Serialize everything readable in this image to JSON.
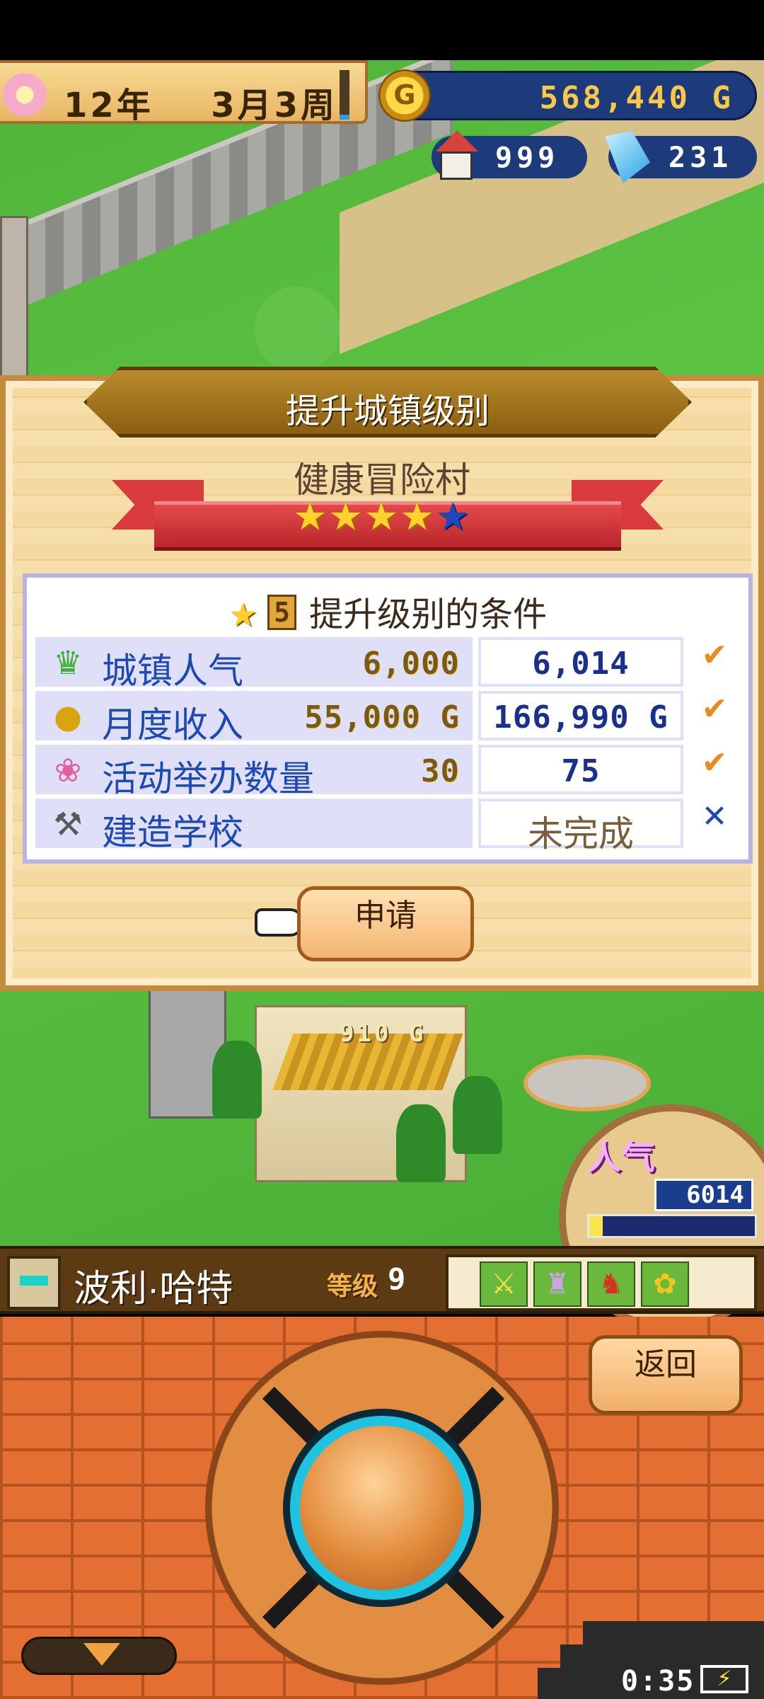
{
  "hud": {
    "year": "12年",
    "month_week": "3月3周",
    "date_progress_fraction": 0.1,
    "gold_coin_symbol": "G",
    "gold": "568,440 G",
    "houses": "999",
    "crystals": "231"
  },
  "dialog": {
    "title": "提升城镇级别",
    "town_name": "健康冒险村",
    "stars_filled": "★★★★",
    "stars_empty": "★",
    "conditions_title": "提升级别的条件",
    "target_tier": "5",
    "conditions": [
      {
        "icon": "popularity-icon",
        "label": "城镇人气",
        "required": "6,000",
        "current": "6,014",
        "met": true,
        "mark": "✔"
      },
      {
        "icon": "income-icon",
        "label": "月度收入",
        "required": "55,000 G",
        "current": "166,990 G",
        "met": true,
        "mark": "✔"
      },
      {
        "icon": "balloon-icon",
        "label": "活动举办数量",
        "required": "30",
        "current": "75",
        "met": true,
        "mark": "✔"
      },
      {
        "icon": "hammer-icon",
        "label": "建造学校",
        "required": "",
        "current": "未完成",
        "met": false,
        "mark": "✕"
      }
    ],
    "apply_label": "申请"
  },
  "world": {
    "floating_price": "910 G",
    "popularity_label": "人气",
    "popularity_value": "6014",
    "popularity_fill_fraction": 0.08
  },
  "character": {
    "name": "波利·哈特",
    "level_label": "等级",
    "level": "9",
    "equipment_icons": [
      "sword-icon",
      "armor-icon",
      "helmet-icon",
      "flower-icon"
    ]
  },
  "controls": {
    "back_label": "返回",
    "clock": "0:35"
  },
  "colors": {
    "accent_blue": "#1e49b3",
    "check_orange": "#ea8b1e",
    "dialog_wood": "#f4d9a1"
  }
}
